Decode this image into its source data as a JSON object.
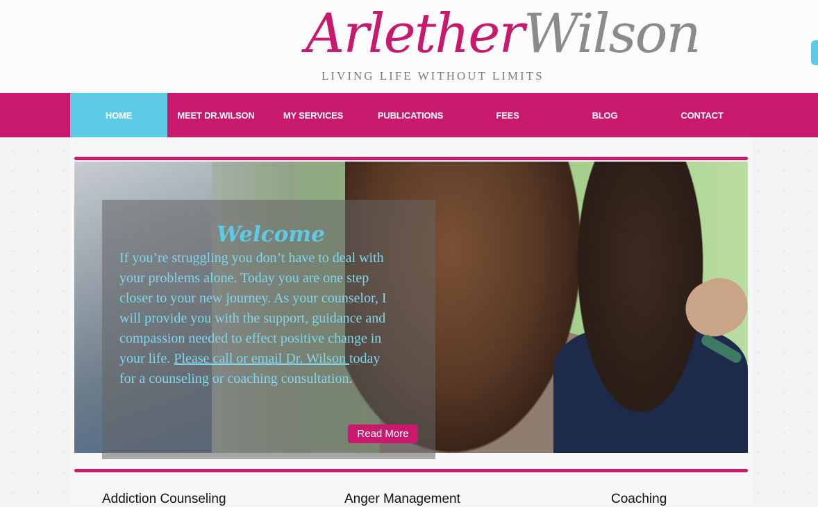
{
  "brand": {
    "name_part1": "Arlether",
    "name_part2": "Wilson",
    "tagline": "LIVING LIFE WITHOUT LIMITS"
  },
  "nav": {
    "items": [
      {
        "label": "HOME"
      },
      {
        "label": "MEET DR.WILSON"
      },
      {
        "label": "MY SERVICES"
      },
      {
        "label": "PUBLICATIONS"
      },
      {
        "label": "FEES"
      },
      {
        "label": "BLOG"
      },
      {
        "label": "CONTACT"
      }
    ]
  },
  "welcome": {
    "title": "Welcome",
    "body_before": "If you’re struggling you don’t have to deal with your problems alone.  Today you are one step closer to your new journey.  As your counselor, I will provide you with the support, guidance and compassion needed to effect positive change in your life.  ",
    "link_text": "Please call or email Dr. Wilson ",
    "body_after": "today for a counseling or coaching consultation.",
    "read_more_label": "Read More"
  },
  "services": [
    {
      "label": "Addiction Counseling"
    },
    {
      "label": "Anger Management"
    },
    {
      "label": "Coaching"
    }
  ],
  "colors": {
    "brand_magenta": "#c8196c",
    "accent_cyan": "#5ecbe6"
  }
}
